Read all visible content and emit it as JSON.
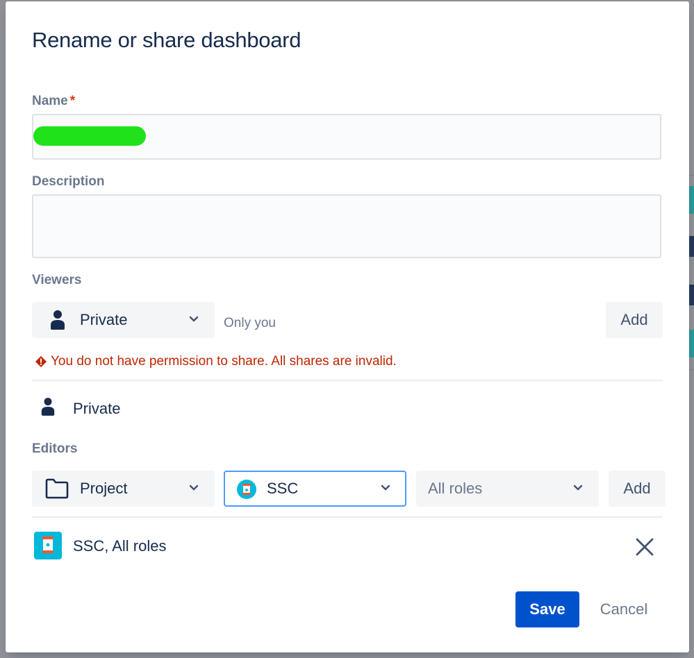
{
  "dialog": {
    "title": "Rename or share dashboard"
  },
  "name_field": {
    "label": "Name",
    "required_marker": "*",
    "value": ""
  },
  "description_field": {
    "label": "Description",
    "value": ""
  },
  "viewers": {
    "label": "Viewers",
    "type_select": {
      "value": "Private",
      "icon": "person-icon"
    },
    "hint": "Only you",
    "add_label": "Add",
    "error": "You do not have permission to share. All shares are invalid.",
    "entries": [
      {
        "label": "Private",
        "icon": "person-icon"
      }
    ]
  },
  "editors": {
    "label": "Editors",
    "type_select": {
      "value": "Project",
      "icon": "folder-icon"
    },
    "project_select": {
      "value": "SSC",
      "icon": "project-avatar-icon"
    },
    "role_select": {
      "value": "All roles"
    },
    "add_label": "Add",
    "entries": [
      {
        "label": "SSC, All roles",
        "icon": "project-avatar-icon"
      }
    ]
  },
  "footer": {
    "save_label": "Save",
    "cancel_label": "Cancel"
  },
  "colors": {
    "primary": "#0052cc",
    "error": "#bf2600",
    "focus_border": "#4c9aff",
    "project_avatar": "#00b8d9"
  }
}
